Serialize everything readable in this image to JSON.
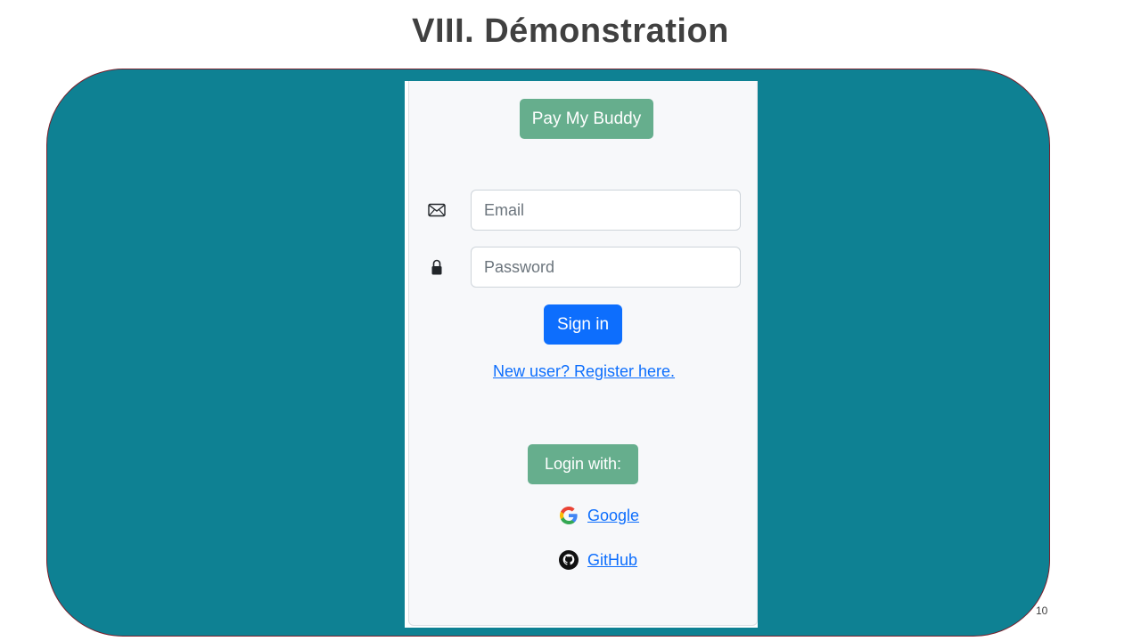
{
  "slide": {
    "title": "VIII. Démonstration",
    "page_number": "10"
  },
  "colors": {
    "panel": "#0e8193",
    "panel_border": "#7a1f2b",
    "badge_green": "#66ae8d",
    "primary_blue": "#0d6efd",
    "card_bg": "#f7f8fa"
  },
  "login_form": {
    "brand_label": "Pay My Buddy",
    "email": {
      "icon": "envelope-icon",
      "placeholder": "Email",
      "value": ""
    },
    "password": {
      "icon": "lock-icon",
      "placeholder": "Password",
      "value": ""
    },
    "signin_label": "Sign in",
    "register_link": "New user? Register here.",
    "login_with_label": "Login with:",
    "providers": [
      {
        "name": "Google",
        "icon": "google-icon"
      },
      {
        "name": "GitHub",
        "icon": "github-icon"
      }
    ]
  }
}
